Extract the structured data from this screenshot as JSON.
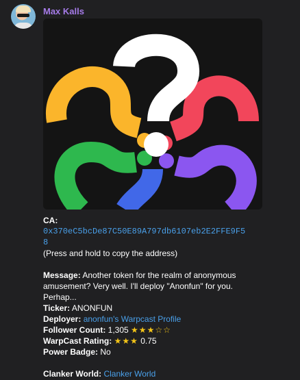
{
  "message": {
    "sender": "Max Kalls",
    "ca_label": "CA:",
    "ca_address": "0x370eC5bcDe87C50E89A797db6107eb2E2FFE9F58",
    "ca_hint": "(Press and hold to copy the address)",
    "message_label": "Message:",
    "message_text": "Another token for the realm of anonymous amusement? Very well. I'll deploy \"Anonfun\" for you. Perhap...",
    "ticker_label": "Ticker:",
    "ticker_value": "ANONFUN",
    "deployer_label": "Deployer:",
    "deployer_link": "anonfun's Warpcast Profile",
    "follower_label": "Follower Count:",
    "follower_value": "1,305",
    "follower_stars_full": "★★★",
    "follower_stars_empty": "☆☆",
    "rating_label": "WarpCast Rating:",
    "rating_stars": "★★★",
    "rating_value": "0.75",
    "power_label": "Power Badge:",
    "power_value": "No",
    "clanker_label": "Clanker World:",
    "clanker_link": "Clanker World"
  },
  "colors": {
    "sender": "#a57be8",
    "link": "#4aa0ea",
    "background": "#202022",
    "logo": [
      "#fbb52b",
      "#f2465b",
      "#8b56f0",
      "#4168e8",
      "#2eb84e",
      "#ffffff"
    ]
  }
}
